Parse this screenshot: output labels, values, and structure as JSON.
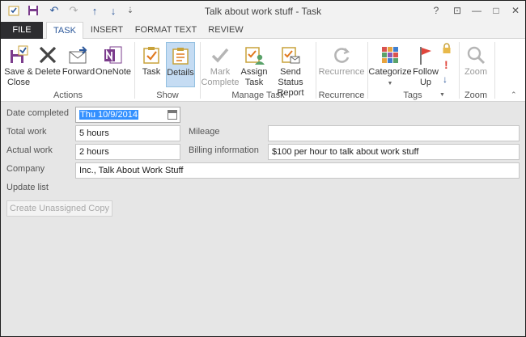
{
  "window": {
    "title": "Talk about work stuff - Task"
  },
  "quick_access": {
    "icons": [
      "task-icon",
      "save-icon",
      "undo-icon",
      "redo-icon",
      "up-arrow-icon",
      "down-arrow-icon",
      "customize-icon"
    ]
  },
  "window_controls": {
    "help": "?",
    "ribbon_display": "⊡",
    "minimize": "—",
    "restore": "□",
    "close": "✕"
  },
  "tabs": {
    "file": "FILE",
    "task": "TASK",
    "insert": "INSERT",
    "format_text": "FORMAT TEXT",
    "review": "REVIEW"
  },
  "ribbon": {
    "actions": {
      "label": "Actions",
      "save_close": "Save &\nClose",
      "delete": "Delete",
      "forward": "Forward",
      "onenote": "OneNote"
    },
    "show": {
      "label": "Show",
      "task": "Task",
      "details": "Details"
    },
    "manage_task": {
      "label": "Manage Task",
      "mark_complete": "Mark\nComplete",
      "assign_task": "Assign\nTask",
      "send_status_report": "Send Status\nReport"
    },
    "recurrence": {
      "label": "Recurrence",
      "recurrence": "Recurrence"
    },
    "tags": {
      "label": "Tags",
      "categorize": "Categorize",
      "follow_up": "Follow\nUp"
    },
    "zoom": {
      "label": "Zoom",
      "zoom": "Zoom"
    }
  },
  "form": {
    "date_completed": {
      "label": "Date completed",
      "value": "Thu 10/9/2014"
    },
    "total_work": {
      "label": "Total work",
      "value": "5 hours"
    },
    "actual_work": {
      "label": "Actual work",
      "value": "2 hours"
    },
    "mileage": {
      "label": "Mileage",
      "value": ""
    },
    "billing_information": {
      "label": "Billing information",
      "value": "$100 per hour to talk about work stuff"
    },
    "company": {
      "label": "Company",
      "value": "Inc., Talk About Work Stuff"
    },
    "update_list": {
      "label": "Update list"
    },
    "create_unassigned_copy": "Create Unassigned Copy"
  },
  "colors": {
    "accent": "#2b579a",
    "file_tab": "#2d2d30",
    "selection": "#3390ff"
  }
}
